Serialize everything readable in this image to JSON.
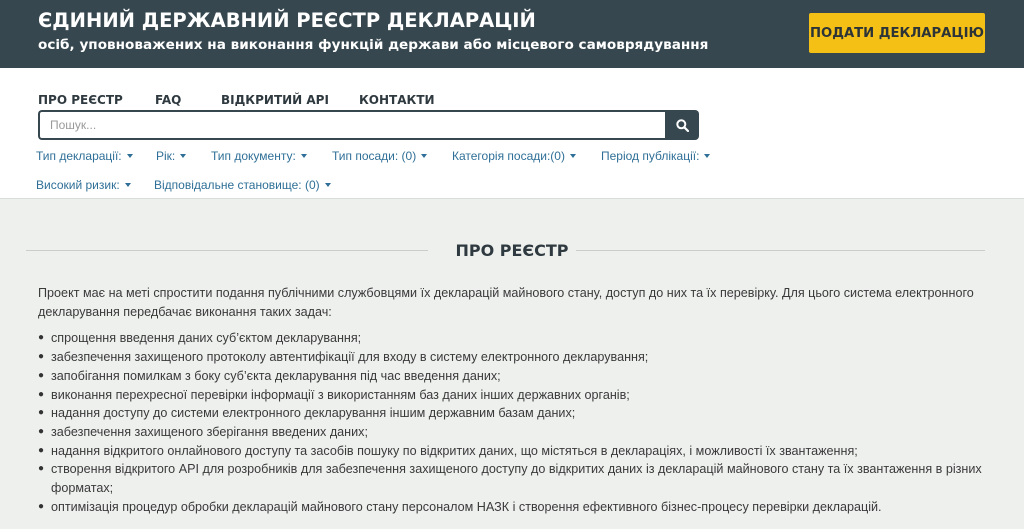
{
  "header": {
    "title": "ЄДИНИЙ ДЕРЖАВНИЙ РЕЄСТР ДЕКЛАРАЦІЙ",
    "subtitle": "осіб, уповноважених на виконання функцій держави або місцевого самоврядування",
    "submit_button": "ПОДАТИ ДЕКЛАРАЦІЮ"
  },
  "nav": {
    "items": [
      "ПРО РЕЄСТР",
      "FAQ",
      "ВІДКРИТИЙ API",
      "КОНТАКТИ"
    ]
  },
  "search": {
    "placeholder": "Пошук...",
    "value": "",
    "icon": "search-icon"
  },
  "filters": [
    "Тип декларації:",
    "Рік:",
    "Тип документу:",
    "Тип посади: (0)",
    "Категорія посади:(0)",
    "Період публікації:",
    "Високий ризик:",
    "Відповідальне становище: (0)"
  ],
  "section": {
    "title": "ПРО РЕЄСТР",
    "intro": "Проект має на меті спростити подання публічними службовцями їх декларацій майнового стану, доступ до них та їх перевірку. Для цього система електронного декларування передбачає виконання таких задач:",
    "tasks": [
      "спрощення введення даних суб’єктом декларування;",
      "забезпечення захищеного протоколу автентифікації для входу в систему електронного декларування;",
      "запобігання помилкам з боку суб’єкта декларування під час введення даних;",
      "виконання перехресної перевірки інформації з використанням баз даних інших державних органів;",
      "надання доступу до системи електронного декларування іншим державним базам даних;",
      "забезпечення захищеного зберігання введених даних;",
      "надання відкритого онлайнового доступу та засобів пошуку по відкритих даних, що містяться в деклараціях, і можливості їх звантаження;",
      "створення відкритого API для розробників для забезпечення захищеного доступу до відкритих даних із декларацій майнового стану та їх звантаження в різних форматах;",
      "оптимізація процедур обробки декларацій майнового стану персоналом НАЗК і створення ефективного бізнес-процесу перевірки декларацій."
    ]
  },
  "colors": {
    "header_bg": "#36474f",
    "accent_yellow": "#f5c016",
    "link_blue": "#2f6f97",
    "page_bg": "#eef0ee"
  }
}
